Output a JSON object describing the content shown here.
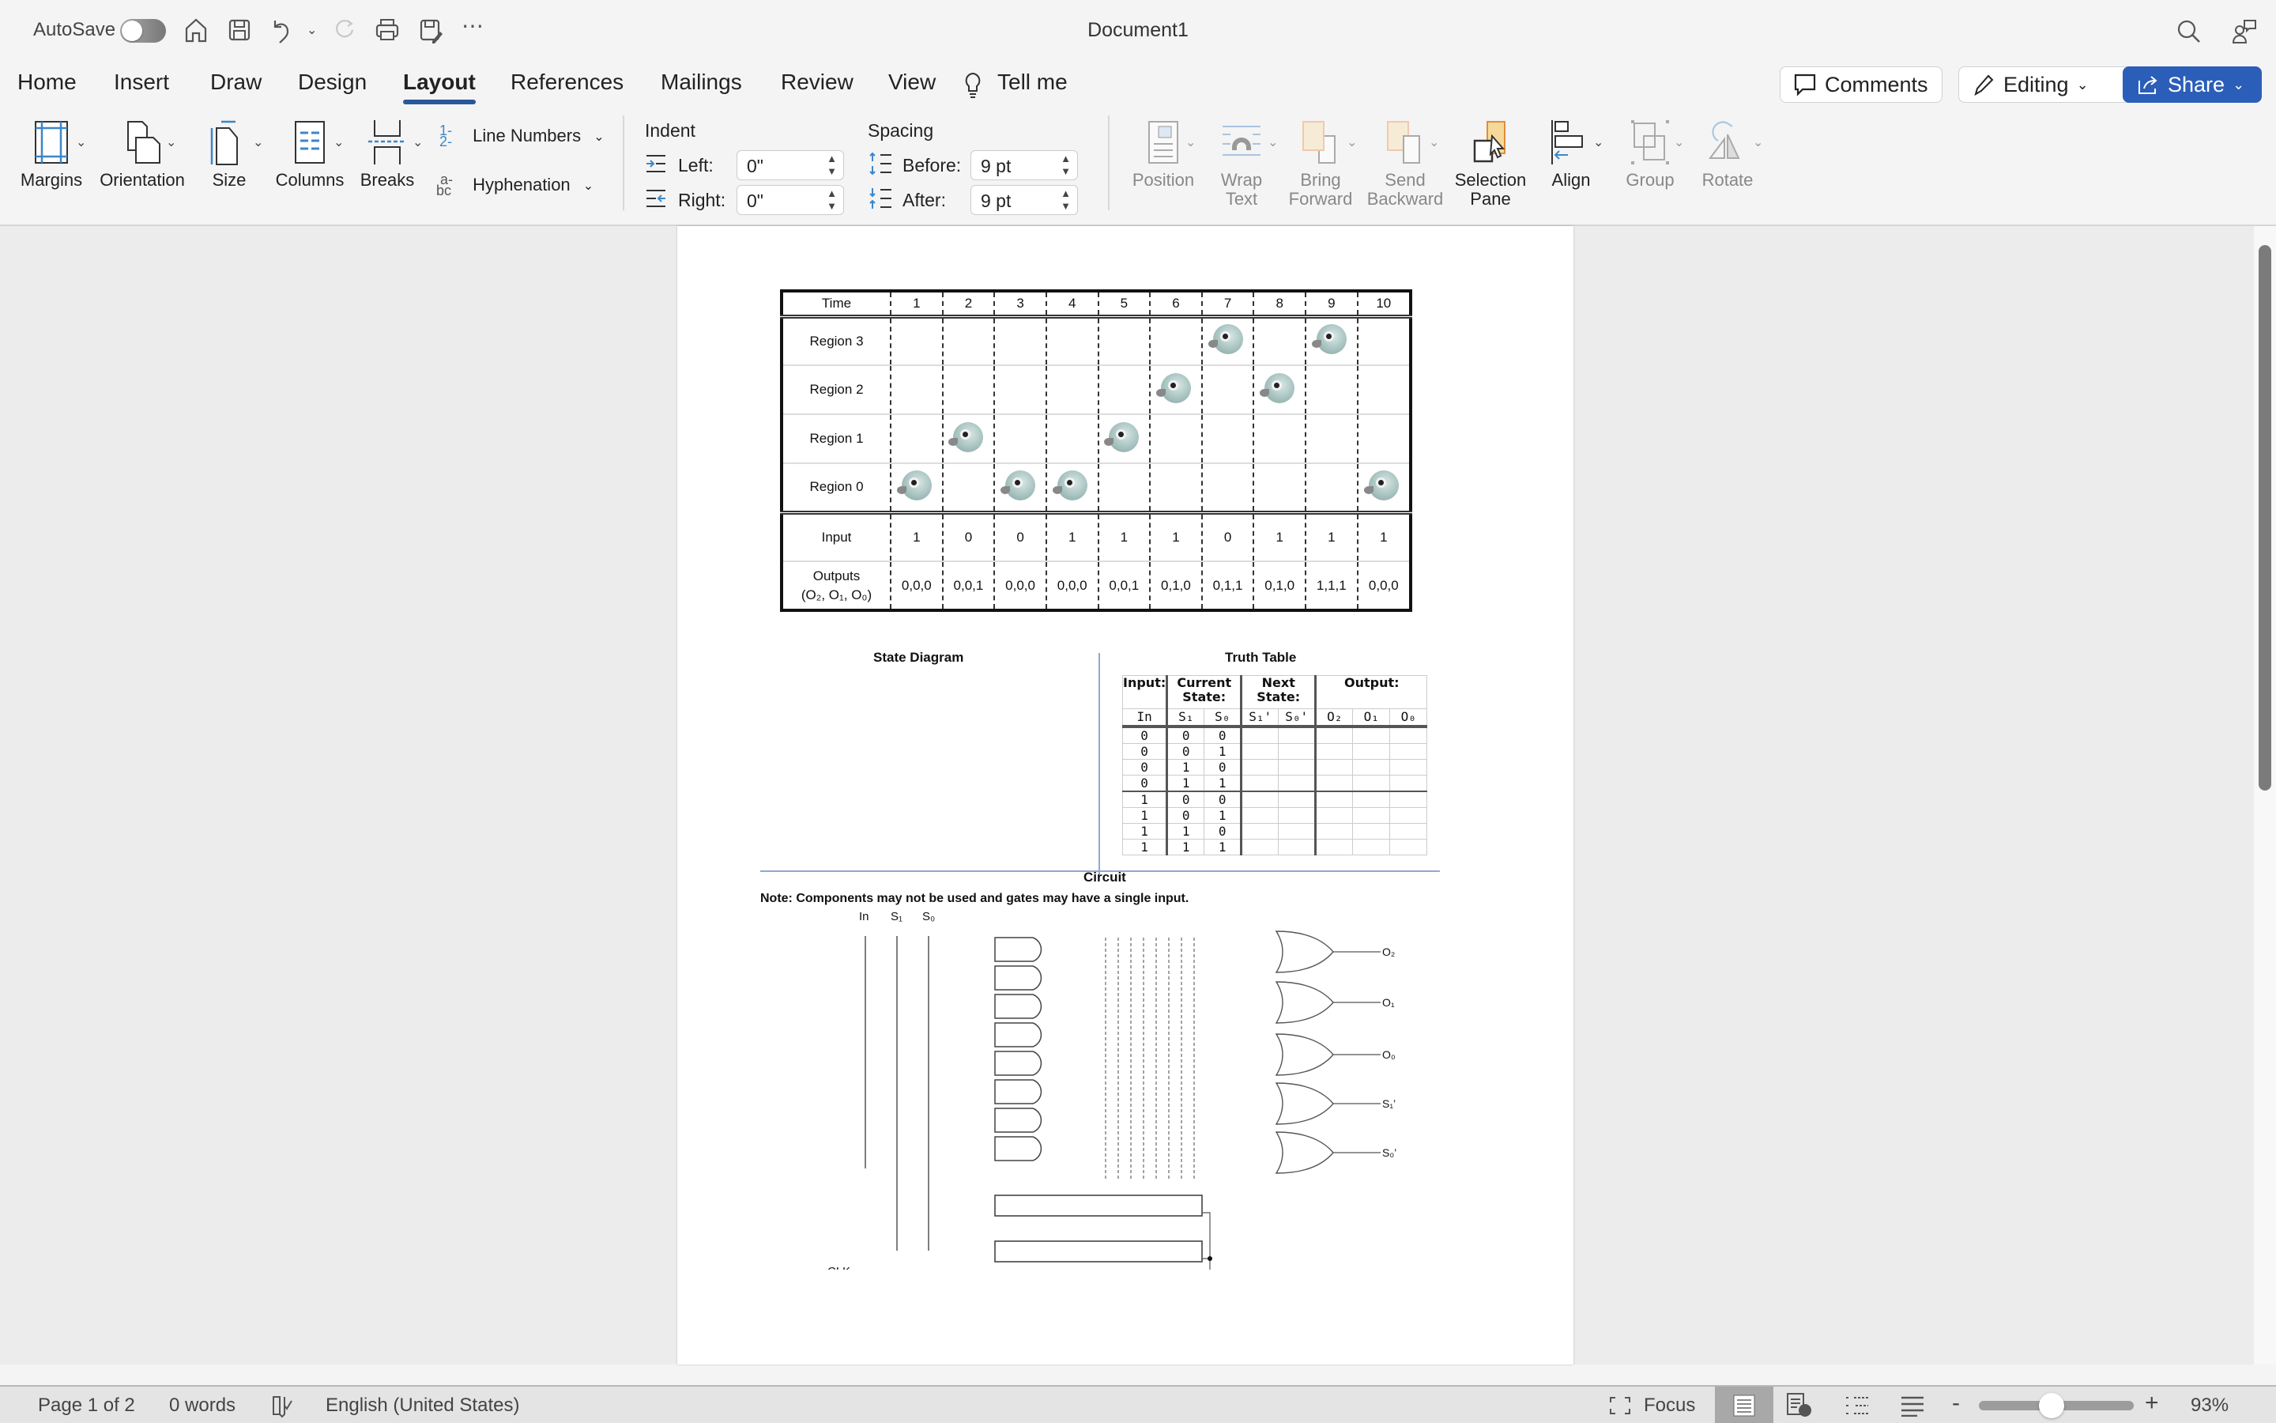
{
  "titlebar": {
    "autosave_label": "AutoSave",
    "autosave_on": false,
    "document_title": "Document1"
  },
  "tabs": [
    {
      "label": "Home"
    },
    {
      "label": "Insert"
    },
    {
      "label": "Draw"
    },
    {
      "label": "Design"
    },
    {
      "label": "Layout",
      "active": true
    },
    {
      "label": "References"
    },
    {
      "label": "Mailings"
    },
    {
      "label": "Review"
    },
    {
      "label": "View"
    }
  ],
  "tell_me": "Tell me",
  "header_buttons": {
    "comments": "Comments",
    "editing": "Editing",
    "share": "Share"
  },
  "ribbon": {
    "page_setup": {
      "margins": "Margins",
      "orientation": "Orientation",
      "size": "Size",
      "columns": "Columns",
      "breaks": "Breaks",
      "line_numbers": "Line Numbers",
      "hyphenation": "Hyphenation"
    },
    "indent": {
      "title": "Indent",
      "left_label": "Left:",
      "left_value": "0\"",
      "right_label": "Right:",
      "right_value": "0\""
    },
    "spacing": {
      "title": "Spacing",
      "before_label": "Before:",
      "before_value": "9 pt",
      "after_label": "After:",
      "after_value": "9 pt"
    },
    "arrange": {
      "position": "Position",
      "wrap_text_1": "Wrap",
      "wrap_text_2": "Text",
      "bring_forward_1": "Bring",
      "bring_forward_2": "Forward",
      "send_backward_1": "Send",
      "send_backward_2": "Backward",
      "selection_pane_1": "Selection",
      "selection_pane_2": "Pane",
      "align": "Align",
      "group": "Group",
      "rotate": "Rotate"
    }
  },
  "document": {
    "schedule": {
      "time_label": "Time",
      "times": [
        "1",
        "2",
        "3",
        "4",
        "5",
        "6",
        "7",
        "8",
        "9",
        "10"
      ],
      "regions": [
        {
          "label": "Region 3",
          "bird_at": [
            7,
            9
          ]
        },
        {
          "label": "Region 2",
          "bird_at": [
            6,
            8
          ]
        },
        {
          "label": "Region 1",
          "bird_at": [
            2,
            5
          ]
        },
        {
          "label": "Region 0",
          "bird_at": [
            1,
            3,
            4,
            10
          ]
        }
      ],
      "input_label": "Input",
      "inputs": [
        "1",
        "0",
        "0",
        "1",
        "1",
        "1",
        "0",
        "1",
        "1",
        "1"
      ],
      "outputs_label": "Outputs",
      "outputs_sublabel": "(O₂, O₁, O₀)",
      "outputs": [
        "0,0,0",
        "0,0,1",
        "0,0,0",
        "0,0,0",
        "0,0,1",
        "0,1,0",
        "0,1,1",
        "0,1,0",
        "1,1,1",
        "0,0,0"
      ]
    },
    "state_diagram_title": "State Diagram",
    "truth_table": {
      "title": "Truth Table",
      "group_headers": [
        "Input:",
        "Current State:",
        "Next State:",
        "Output:"
      ],
      "columns": [
        "In",
        "S₁",
        "S₀",
        "S₁'",
        "S₀'",
        "O₂",
        "O₁",
        "O₀"
      ],
      "rows": [
        [
          "0",
          "0",
          "0",
          "",
          "",
          "",
          "",
          ""
        ],
        [
          "0",
          "0",
          "1",
          "",
          "",
          "",
          "",
          ""
        ],
        [
          "0",
          "1",
          "0",
          "",
          "",
          "",
          "",
          ""
        ],
        [
          "0",
          "1",
          "1",
          "",
          "",
          "",
          "",
          ""
        ],
        [
          "1",
          "0",
          "0",
          "",
          "",
          "",
          "",
          ""
        ],
        [
          "1",
          "0",
          "1",
          "",
          "",
          "",
          "",
          ""
        ],
        [
          "1",
          "1",
          "0",
          "",
          "",
          "",
          "",
          ""
        ],
        [
          "1",
          "1",
          "1",
          "",
          "",
          "",
          "",
          ""
        ]
      ]
    },
    "circuit": {
      "title": "Circuit",
      "note": "Note: Components may not be used and gates may have a single input.",
      "inputs": [
        "In",
        "S₁",
        "S₀"
      ],
      "and_gate_count": 8,
      "or_outputs": [
        "O₂",
        "O₁",
        "O₀",
        "S₁’",
        "S₀’"
      ],
      "clock_label": "CLK",
      "flip_flop_count": 2
    }
  },
  "statusbar": {
    "page": "Page 1 of 2",
    "words": "0 words",
    "language": "English (United States)",
    "focus": "Focus",
    "zoom_percent": 93,
    "zoom_label": "93%"
  },
  "scroll": {
    "position_fraction": 0.0,
    "visible_fraction": 0.48
  }
}
